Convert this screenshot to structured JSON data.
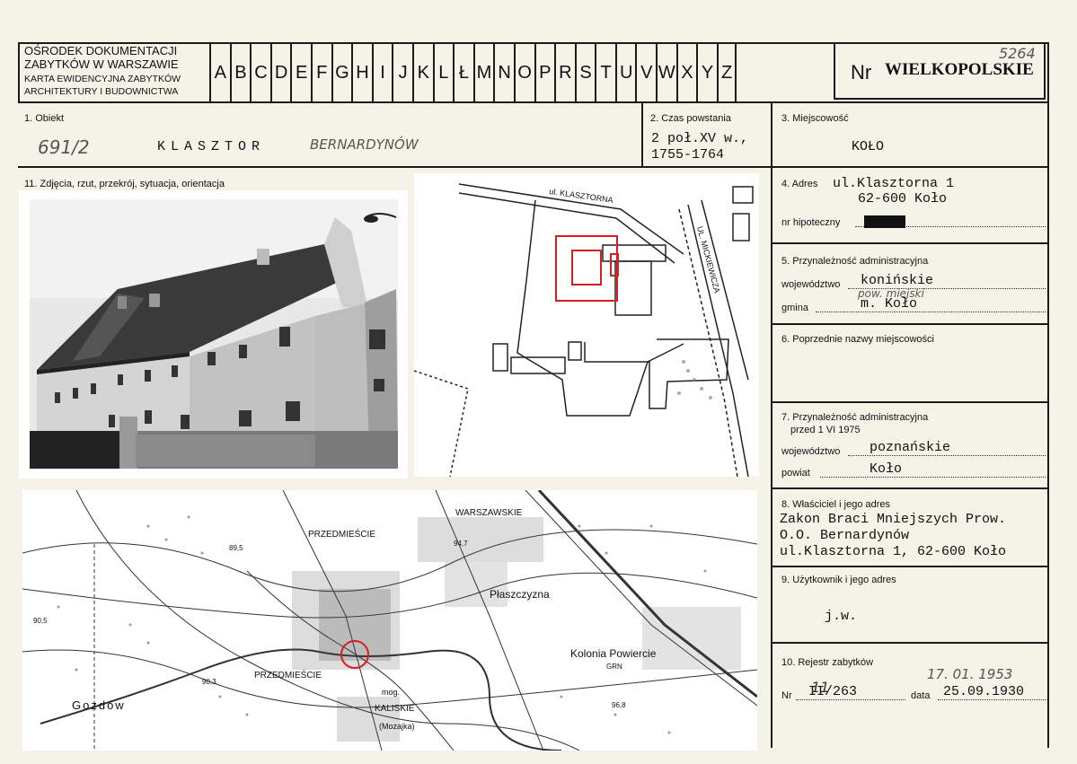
{
  "header": {
    "institution_lines": [
      "OŚRODEK DOKUMENTACJI",
      "ZABYTKÓW W WARSZAWIE",
      "KARTA EWIDENCYJNA ZABYTKÓW",
      "ARCHITEKTURY I BUDOWNICTWA"
    ],
    "letters": [
      "A",
      "B",
      "C",
      "D",
      "E",
      "F",
      "G",
      "H",
      "I",
      "J",
      "K",
      "L",
      "Ł",
      "M",
      "N",
      "O",
      "P",
      "R",
      "S",
      "T",
      "U",
      "V",
      "W",
      "X",
      "Y",
      "Z"
    ],
    "nr_label": "Nr",
    "nr_value": "WIELKOPOLSKIE",
    "nr_handwritten": "5264"
  },
  "fields": {
    "obiekt_label": "1. Obiekt",
    "obiekt_hand_number": "691/2",
    "obiekt_value": "KLASZTOR",
    "obiekt_hand_value": "BERNARDYNÓW",
    "czas_label": "2. Czas powstania",
    "czas_value_1": "2 poł.XV w.,",
    "czas_value_2": "1755-1764",
    "miejscowosc_label": "3. Miejscowość",
    "miejscowosc_value": "KOŁO",
    "zdjecia_label": "11. Zdjęcia, rzut, przekrój, sytuacja, orientacja",
    "adres_label": "4. Adres",
    "adres_value_1": "ul.Klasztorna 1",
    "adres_value_2": "62-600 Koło",
    "hipoteczny_label": "nr hipoteczny",
    "przynaleznosc_label": "5. Przynależność administracyjna",
    "wojewodztwo_label": "województwo",
    "wojewodztwo_value": "konińskie",
    "gmina_hand": "pow. miejski",
    "gmina_label": "gmina",
    "gmina_value": "m. Koło",
    "poprzednie_label": "6. Poprzednie nazwy miejscowości",
    "przynaleznosc75_label_1": "7. Przynależność administracyjna",
    "przynaleznosc75_label_2": "przed 1 VI 1975",
    "wojewodztwo75_label": "województwo",
    "wojewodztwo75_value": "poznańskie",
    "powiat_label": "powiat",
    "powiat_value": "Koło",
    "wlasciciel_label": "8. Właściciel i jego adres",
    "wlasciciel_line_1": "Zakon Braci Mniejszych Prow.",
    "wlasciciel_line_2": "O.O. Bernardynów",
    "wlasciciel_line_3": "ul.Klasztorna 1, 62-600 Koło",
    "uzytkownik_label": "9. Użytkownik i jego adres",
    "uzytkownik_value": "j.w.",
    "rejestr_label": "10. Rejestr zabytków",
    "rejestr_nr_label": "Nr",
    "rejestr_nr_value": "II/263",
    "rejestr_nr_hand": "11",
    "rejestr_data_label": "data",
    "rejestr_data_value": "25.09.1930",
    "rejestr_data_hand": "17. 01. 1953"
  },
  "plan": {
    "street_1": "ul. KLASZTORNA",
    "street_2": "UL. MICKIEWICZA"
  },
  "map": {
    "labels": [
      "PRZEDMIEŚCIE",
      "WARSZAWSKIE",
      "Płaszczyzna",
      "Kolonia Powiercie",
      "GRN",
      "PRZEDMIEŚCIE",
      "KALISKIE",
      "Gozdów",
      "mog.",
      "(Mozajka)",
      "89,5",
      "90,5",
      "90,3",
      "96,8",
      "94,7"
    ]
  },
  "colors": {
    "paper": "#f5f2e8",
    "ink": "#1a1a1a",
    "red_mark": "#d32020"
  }
}
